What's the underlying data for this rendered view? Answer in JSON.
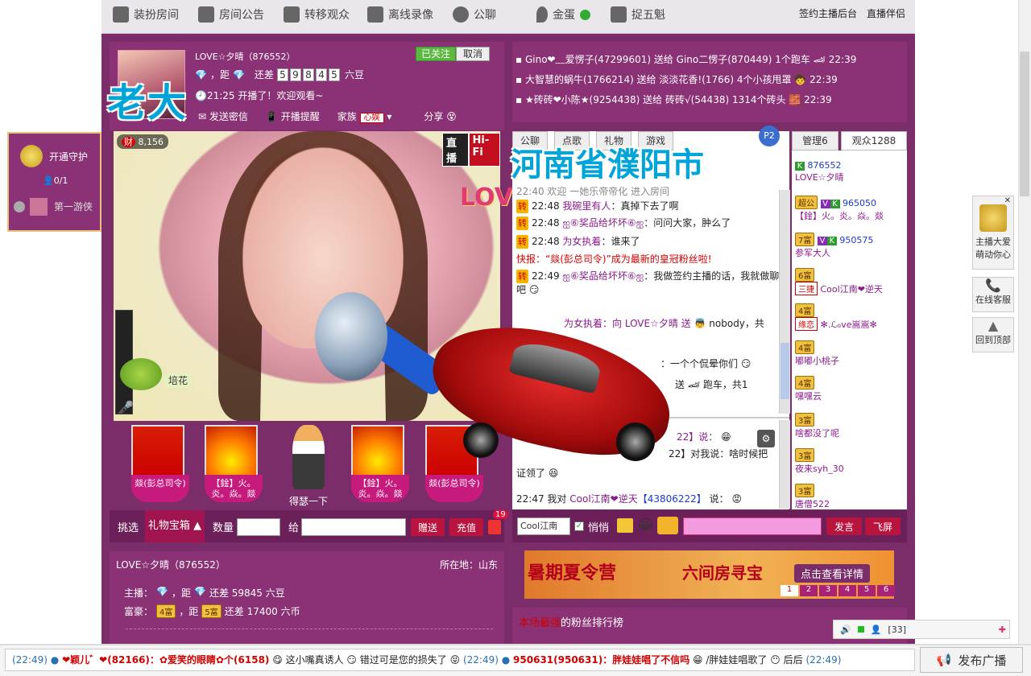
{
  "topnav": {
    "items": [
      "装扮房间",
      "房间公告",
      "转移观众",
      "离线录像",
      "公聊",
      "金蛋",
      "捉五魁"
    ],
    "right": [
      "签约主播后台",
      "直播伴侣"
    ]
  },
  "anchor": {
    "name_id": "LOVE☆夕晴（876552）",
    "follow_btn": "已关注",
    "cancel_btn": "取消",
    "distance": "，距",
    "diff_label": "还差",
    "diff_digits": [
      "5",
      "9",
      "8",
      "4",
      "5"
    ],
    "diff_unit": "六豆",
    "start_info": "21:25 开播了！欢迎观看~",
    "actions": [
      "发送密信",
      "开播提醒",
      "家族",
      "分享"
    ],
    "family_tag": "心娱",
    "overlay_name": "老大"
  },
  "video": {
    "wealth_label": "财",
    "wealth": "8,156",
    "live_tag": "直播",
    "hifi_tag": "Hi-Fi",
    "love_text": "LOVE",
    "plant_label": "培花"
  },
  "gifts": [
    {
      "label": "燚(彭总司令)"
    },
    {
      "label": "【鍂】火。炎。焱。燚"
    },
    {
      "label": "得瑟一下"
    },
    {
      "label": "【鍂】火。炎。焱。燚"
    },
    {
      "label": "燚(彭总司令)"
    }
  ],
  "gift_toolbar": {
    "pick": "挑选",
    "box": "礼物宝箱",
    "qty_label": "数量",
    "to_label": "给",
    "send": "赠送",
    "recharge": "充值",
    "badge": "19"
  },
  "anchor_info": {
    "name_id": "LOVE☆夕晴（876552）",
    "location": "所在地：山东",
    "host_prefix": "主播：",
    "host_rest": "，距",
    "host_diff": "还差 59845 六豆",
    "rich_prefix": "富豪：",
    "rich_level": "4富",
    "rich_rest": "，距",
    "rich_next": "5富",
    "rich_diff": "还差 17400 六币"
  },
  "gift_log": [
    {
      "text": "Gino❤﹏爱愣子(47299601) 送给 Gino二愣子(870449) 1个跑车",
      "time": "22:39"
    },
    {
      "text": "大智慧的蜗牛(1766214) 送给 淡淡花香!(1766) 4个小孩甩罩",
      "time": "22:39"
    },
    {
      "text": "★砖砖❤小陈★(9254438) 送给 砖砖√(54438) 1314个砖头",
      "time": "22:39"
    }
  ],
  "chat_tabs": [
    "公聊",
    "点歌",
    "礼物",
    "游戏"
  ],
  "user_tabs": [
    "管理6",
    "观众1288"
  ],
  "overlay_location": "河南省濮阳市",
  "chat": [
    {
      "time": "22:40",
      "text": "欢迎 一她乐帝帝化 进入房间"
    },
    {
      "time": "22:48",
      "user": "我碗里有人",
      "msg": "：真掉下去了啊"
    },
    {
      "time": "22:48",
      "user": "ஐ⑥奖品给坏坏⑥ஐ",
      "msg": "：问问大家，肿么了"
    },
    {
      "time": "22:48",
      "user": "为女执着",
      "msg": "：谁来了"
    },
    {
      "news": "快报：“燚(彭总司令)”成为最新的皇冠粉丝啦!"
    },
    {
      "time": "22:49",
      "user": "ஐ⑥奖品给坏坏⑥ஐ",
      "msg": "：我做签约主播的话，我就做聊吧"
    },
    {
      "partial": "为女执着：向 LOVE☆夕晴 送",
      "tail": "nobody，共"
    },
    {
      "partial2": "：一个个侃晕你们"
    },
    {
      "partial3": "送",
      "tail": "跑车，共1"
    }
  ],
  "chat2": [
    {
      "text": "22】说："
    },
    {
      "text": "22】对我说：啥时候把"
    },
    {
      "text": "证领了"
    },
    {
      "time": "22:47",
      "pre": "我对",
      "user": "Cool江南❤逆天",
      "uid": "【43806222】",
      "msg": "说："
    }
  ],
  "users": [
    {
      "id": "876552",
      "name": "LOVE☆夕晴"
    },
    {
      "badge": "超公",
      "id": "965050",
      "name": "【鍂】火。炎。焱。燚"
    },
    {
      "badge": "7富",
      "id": "950575",
      "name": "参军大人"
    },
    {
      "badge": "6富",
      "tag": "三捷",
      "name": "Cool江南❤逆天"
    },
    {
      "badge": "4富",
      "tag": "缘恋",
      "name": "✻.ℒℴve嵩嵩✻"
    },
    {
      "badge": "4富",
      "name": "嘟嘟小桃子"
    },
    {
      "badge": "4富",
      "name": "嘿嘿云"
    },
    {
      "badge": "3富",
      "name": "啥都没了呢"
    },
    {
      "badge": "3富",
      "name": "夜来syh_30"
    },
    {
      "badge": "3富",
      "name": "唐僧522"
    }
  ],
  "chatbar": {
    "target": "Cool江南",
    "quiet": "悄悄",
    "send": "发言",
    "fly": "飞屏"
  },
  "banner": {
    "title": "暑期夏令营",
    "subtitle": "六间房寻宝",
    "detail": "点击查看详情",
    "pages": [
      "1",
      "2",
      "3",
      "4",
      "5",
      "6"
    ]
  },
  "fans": {
    "prefix": "本场最强",
    "title": "的粉丝排行榜"
  },
  "guard": {
    "open": "开通守护",
    "count": "0/1",
    "first": "第一游侠"
  },
  "dock": [
    {
      "label": "主播大爱萌动你心"
    },
    {
      "label": "在线客服"
    },
    {
      "label": "回到顶部"
    }
  ],
  "status_widget": {
    "count": "[33]"
  },
  "ticker": {
    "items": [
      "(22:49)",
      "❤颖儿゛❤(82166)：✿爱笑的眼睛✿个(6158)",
      "这小嘴真诱人",
      "错过可是您的损失了",
      "(22:49)",
      "950631(950631)：胖娃娃唱了不信吗",
      "/胖娃娃唱歌了",
      "后后",
      "(22:49)"
    ],
    "publish": "发布广播"
  },
  "colors": {
    "bg_main": "#7a2d68",
    "panel": "#8a3275",
    "accent_red": "#b8143e",
    "green": "#5cb843"
  }
}
